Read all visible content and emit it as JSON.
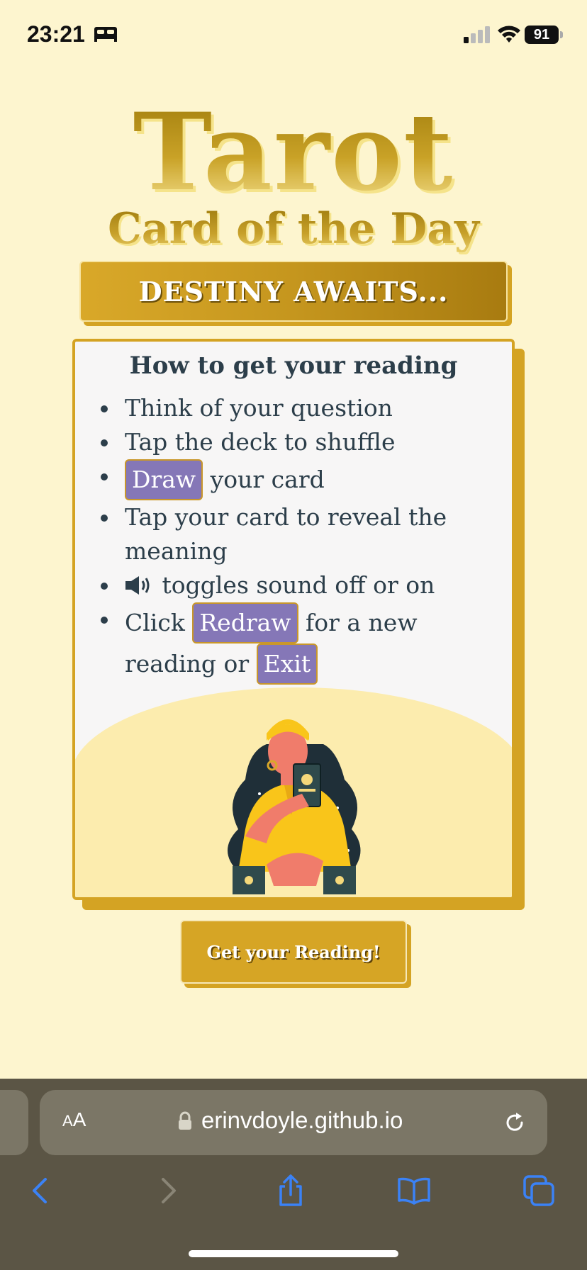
{
  "status_bar": {
    "time": "23:21",
    "battery": "91",
    "icons": [
      "bed-icon",
      "cellular-signal-icon",
      "wifi-icon",
      "battery-icon"
    ]
  },
  "header": {
    "title": "Tarot",
    "subtitle": "Card of the Day"
  },
  "banner": {
    "text": "DESTINY AWAITS..."
  },
  "instructions": {
    "heading": "How to get your reading",
    "step1": "Think of your question",
    "step2": "Tap the deck to shuffle",
    "step3_pill": "Draw",
    "step3_rest": " your card",
    "step4": "Tap your card to reveal the meaning",
    "step5_icon": "speaker-icon",
    "step5_rest": " toggles sound off or on",
    "step6_prefix": "Click ",
    "step6_pill1": "Redraw",
    "step6_mid": " for a new reading or ",
    "step6_pill2": "Exit"
  },
  "illustration": {
    "name": "fortune-teller-illustration"
  },
  "actions": {
    "get_reading": "Get your Reading!"
  },
  "browser": {
    "text_size_label_small": "A",
    "text_size_label_large": "A",
    "url": "erinvdoyle.github.io",
    "icons": [
      "lock-icon",
      "reload-icon",
      "back-icon",
      "forward-icon",
      "share-icon",
      "bookmarks-icon",
      "tabs-icon"
    ]
  },
  "colors": {
    "background": "#fdf5cf",
    "gold": "#d4a323",
    "pill_purple": "#8577b7",
    "card_bg": "#f7f6f6",
    "text_dark": "#2c3e4a",
    "browser_chrome": "#5b5545",
    "browser_link": "#3b82f6"
  }
}
